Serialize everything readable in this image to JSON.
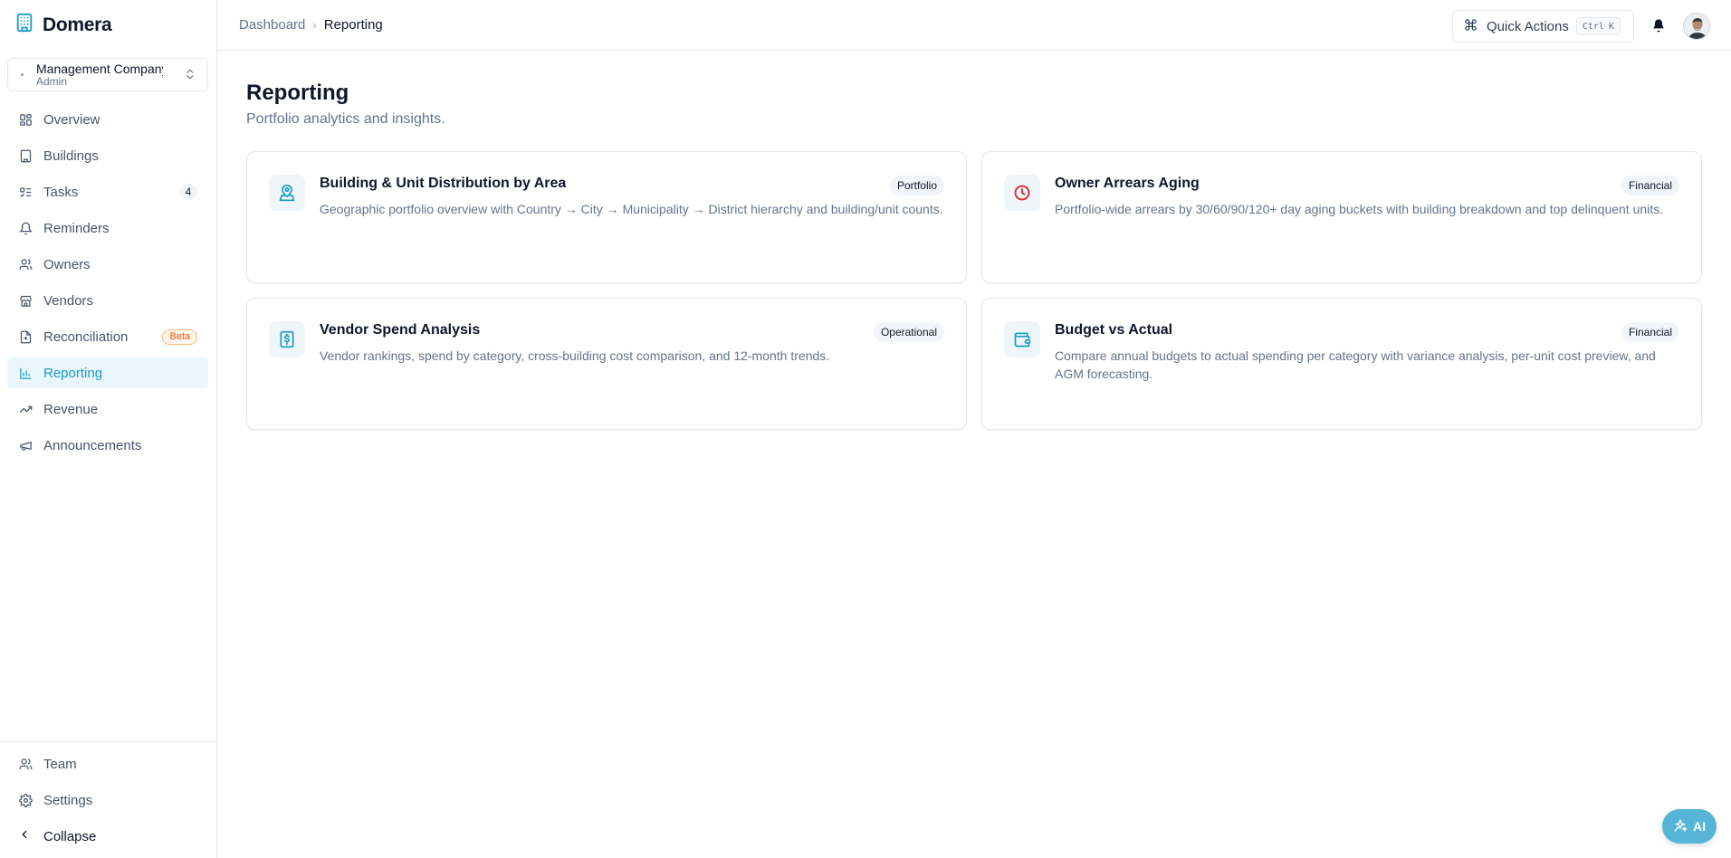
{
  "brand": {
    "name": "Domera"
  },
  "org": {
    "name": "Management Company",
    "role": "Admin"
  },
  "nav": [
    {
      "label": "Overview",
      "icon": "overview-icon"
    },
    {
      "label": "Buildings",
      "icon": "building-icon"
    },
    {
      "label": "Tasks",
      "icon": "tasks-icon",
      "count": "4"
    },
    {
      "label": "Reminders",
      "icon": "bell-icon"
    },
    {
      "label": "Owners",
      "icon": "users-icon"
    },
    {
      "label": "Vendors",
      "icon": "store-icon"
    },
    {
      "label": "Reconciliation",
      "icon": "reconcile-icon",
      "badge": "Beta"
    },
    {
      "label": "Reporting",
      "icon": "chart-icon",
      "active": true
    },
    {
      "label": "Revenue",
      "icon": "trending-up-icon"
    },
    {
      "label": "Announcements",
      "icon": "megaphone-icon"
    }
  ],
  "bottom_nav": [
    {
      "label": "Team",
      "icon": "users-icon"
    },
    {
      "label": "Settings",
      "icon": "gear-icon"
    }
  ],
  "collapse_label": "Collapse",
  "breadcrumb": {
    "parent": "Dashboard",
    "current": "Reporting"
  },
  "quick_actions": {
    "label": "Quick Actions",
    "kbd1": "Ctrl",
    "kbd2": "K"
  },
  "page": {
    "title": "Reporting",
    "subtitle": "Portfolio analytics and insights."
  },
  "cards": [
    {
      "title": "Building & Unit Distribution by Area",
      "badge": "Portfolio",
      "icon": "map-pin-icon",
      "description": "Geographic portfolio overview with Country → City → Municipality → District hierarchy and building/unit counts."
    },
    {
      "title": "Owner Arrears Aging",
      "badge": "Financial",
      "icon": "clock-icon",
      "description": "Portfolio-wide arrears by 30/60/90/120+ day aging buckets with building breakdown and top delinquent units."
    },
    {
      "title": "Vendor Spend Analysis",
      "badge": "Operational",
      "icon": "receipt-icon",
      "description": "Vendor rankings, spend by category, cross-building cost comparison, and 12-month trends."
    },
    {
      "title": "Budget vs Actual",
      "badge": "Financial",
      "icon": "wallet-icon",
      "description": "Compare annual budgets to actual spending per category with variance analysis, per-unit cost preview, and AGM forecasting."
    }
  ],
  "ai_button": {
    "label": "AI"
  },
  "colors": {
    "accent": "#1a9bc4",
    "danger": "#dc2626",
    "ai": "#56b5d6"
  }
}
